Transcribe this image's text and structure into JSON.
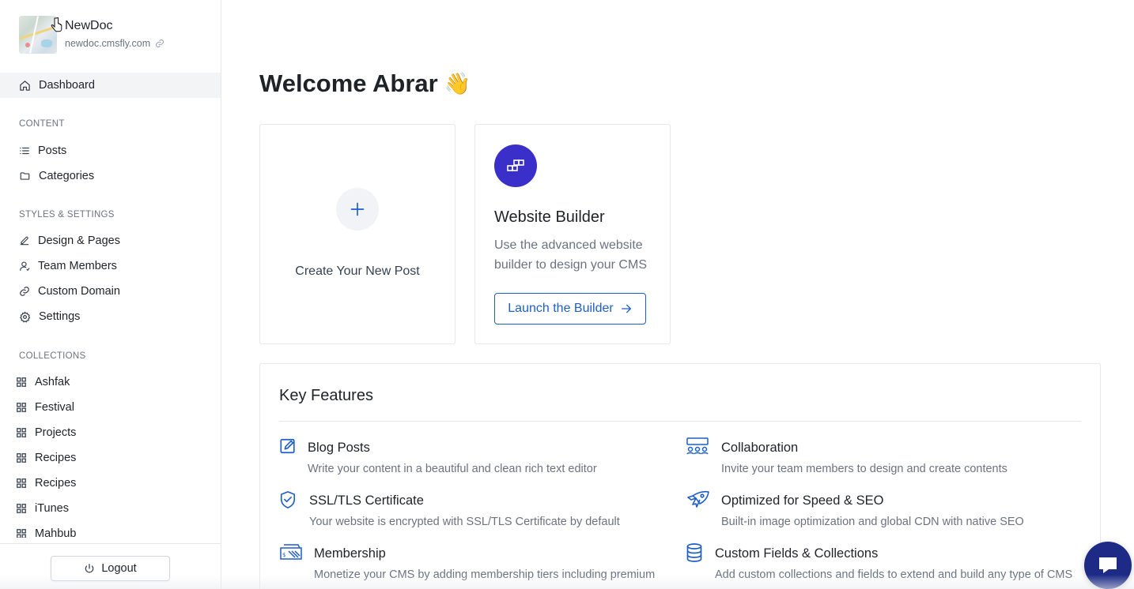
{
  "brand": {
    "name": "NewDoc",
    "url": "newdoc.cmsfly.com"
  },
  "nav": {
    "dashboard": "Dashboard",
    "content_label": "CONTENT",
    "posts": "Posts",
    "categories": "Categories",
    "styles_label": "STYLES & SETTINGS",
    "design_pages": "Design & Pages",
    "team_members": "Team Members",
    "custom_domain": "Custom Domain",
    "settings": "Settings",
    "collections_label": "COLLECTIONS",
    "collections": [
      "Ashfak",
      "Festival",
      "Projects",
      "Recipes",
      "Recipes",
      "iTunes",
      "Mahbub"
    ]
  },
  "logout": "Logout",
  "main": {
    "welcome": "Welcome Abrar",
    "wave": "👋",
    "create_card": {
      "label": "Create Your New Post"
    },
    "builder_card": {
      "title": "Website Builder",
      "description": "Use the advanced website builder to design your CMS",
      "button": "Launch the Builder"
    },
    "features": {
      "title": "Key Features",
      "items": [
        {
          "icon": "edit-icon",
          "title": "Blog Posts",
          "desc": "Write your content in a beautiful and clean rich text editor"
        },
        {
          "icon": "team-icon",
          "title": "Collaboration",
          "desc": "Invite your team members to design and create contents"
        },
        {
          "icon": "shield-check-icon",
          "title": "SSL/TLS Certificate",
          "desc": "Your website is encrypted with SSL/TLS Certificate by default"
        },
        {
          "icon": "rocket-icon",
          "title": "Optimized for Speed & SEO",
          "desc": "Built-in image optimization and global CDN with native SEO"
        },
        {
          "icon": "membership-card-icon",
          "title": "Membership",
          "desc": "Monetize your CMS by adding membership tiers including premium"
        },
        {
          "icon": "database-icon",
          "title": "Custom Fields & Collections",
          "desc": "Add custom collections and fields to extend and build any type of CMS"
        }
      ]
    }
  },
  "colors": {
    "accent": "#1d5fc9",
    "builder_icon_bg": "#3b2fc9",
    "chat_bg": "#1d2b86"
  }
}
